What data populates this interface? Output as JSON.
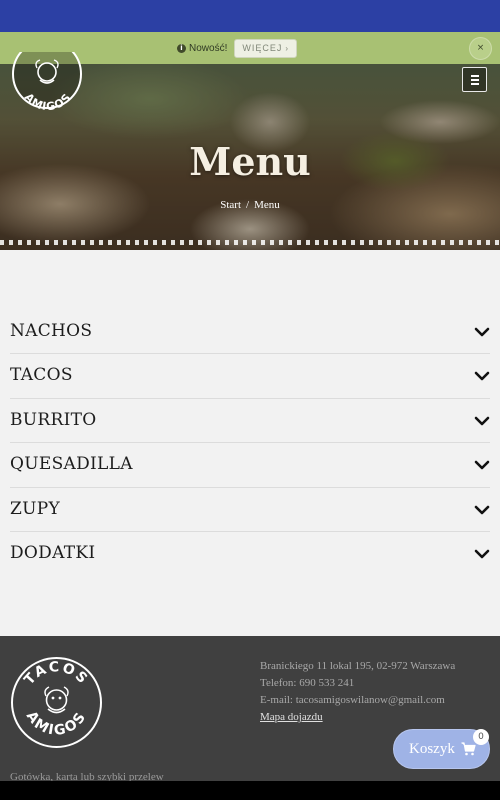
{
  "notice": {
    "text": "Nowość!",
    "button_label": "WIĘCEJ",
    "close_label": "×",
    "info_glyph": "i"
  },
  "hero": {
    "title": "Menu",
    "breadcrumb": {
      "home": "Start",
      "separator": "/",
      "current": "Menu"
    }
  },
  "logo": {
    "brand_text": [
      "TACOS",
      "AMIGOS"
    ]
  },
  "menu": {
    "categories": [
      {
        "label": "NACHOS"
      },
      {
        "label": "TACOS"
      },
      {
        "label": "BURRITO"
      },
      {
        "label": "QUESADILLA"
      },
      {
        "label": "ZUPY"
      },
      {
        "label": "DODATKI"
      }
    ]
  },
  "footer": {
    "address": "Branickiego 11 lokal 195, 02-972 Warszawa",
    "phone": "Telefon: 690 533 241",
    "email": "E-mail: tacosamigoswilanow@gmail.com",
    "map_link": "Mapa dojazdu",
    "payment_note": "Gotówka, karta lub szybki przelew"
  },
  "cart": {
    "label": "Koszyk",
    "count": "0"
  },
  "colors": {
    "statusbar": "#2c40a4",
    "notice_bar": "#a8c173",
    "footer": "#404040",
    "cart_button": "#9fb3e6"
  },
  "icons": {
    "notice": "info-icon",
    "close": "close-icon",
    "menu": "hamburger-menu-icon",
    "accordion": "chevron-down-icon",
    "cart": "shopping-cart-icon"
  }
}
